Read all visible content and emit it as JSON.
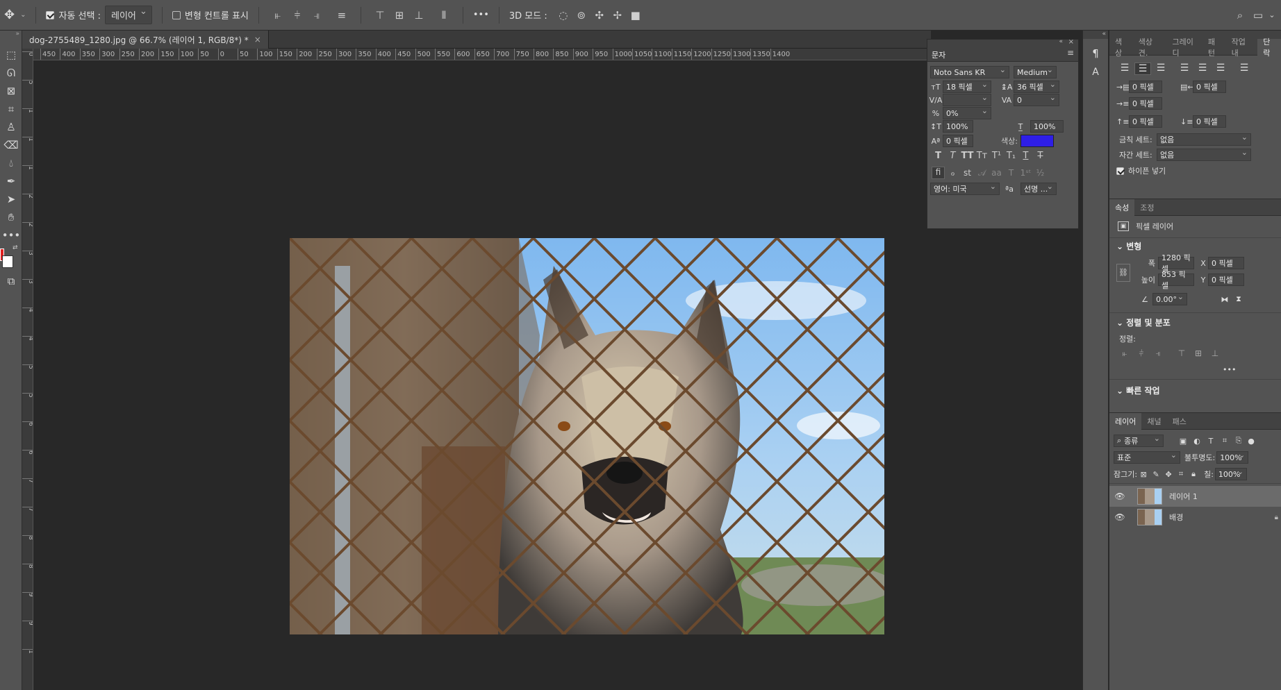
{
  "options_bar": {
    "auto_select_label": "자동 선택 :",
    "auto_select_value": "레이어",
    "transform_controls_label": "변형 컨트롤 표시",
    "mode_3d_label": "3D 모드 :",
    "more": "•••"
  },
  "document": {
    "tab_title": "dog-2755489_1280.jpg @ 66.7% (레이어 1, RGB/8*) *",
    "close": "×"
  },
  "ruler": {
    "h_labels": [
      "450",
      "400",
      "350",
      "300",
      "250",
      "200",
      "150",
      "100",
      "50",
      "0",
      "50",
      "100",
      "150",
      "200",
      "250",
      "300",
      "350",
      "400",
      "450",
      "500",
      "550",
      "600",
      "650",
      "700",
      "750",
      "800",
      "850",
      "900",
      "950",
      "1000",
      "1050",
      "1100",
      "1150",
      "1200",
      "1250",
      "1300",
      "1350",
      "1400"
    ],
    "v_labels": [
      "0",
      "5",
      "1",
      "1",
      "1",
      "2",
      "2",
      "3",
      "3",
      "4",
      "4",
      "5",
      "5",
      "6",
      "6",
      "7",
      "7",
      "8",
      "8",
      "9",
      "9",
      "1"
    ]
  },
  "character_panel": {
    "title": "문자",
    "font_family": "Noto Sans KR",
    "font_style": "Medium",
    "font_size": "18 픽셀",
    "leading": "36 픽셀",
    "kerning": "",
    "tracking": "0",
    "tsume": "0%",
    "vertical_scale": "100%",
    "horizontal_scale": "100%",
    "baseline_shift": "0 픽셀",
    "color_label": "색상:",
    "color_swatch": "#2e1ee6",
    "language": "영어: 미국",
    "antialias_icon": "ªa",
    "antialias": "선명 ..."
  },
  "right_dock": {
    "top_tabs": [
      "색상",
      "색상 견.",
      "그레이디",
      "패턴",
      "작업 내",
      "단락"
    ],
    "paragraph": {
      "indent_left": "0 픽셀",
      "indent_right": "0 픽셀",
      "indent_first": "0 픽셀",
      "space_before": "0 픽셀",
      "space_after": "0 픽셀",
      "kinsoku_label": "금칙 세트:",
      "kinsoku_value": "없음",
      "mojikumi_label": "자간 세트:",
      "mojikumi_value": "없음",
      "hyphenate_label": "하이픈 넣기"
    },
    "props_tabs": [
      "속성",
      "조정"
    ],
    "properties": {
      "layer_type": "픽셀 레이어",
      "transform_title": "변형",
      "width_label": "폭",
      "width_value": "1280 픽셀",
      "x_label": "X",
      "x_value": "0 픽셀",
      "height_label": "높이",
      "height_value": "853 픽셀",
      "y_label": "Y",
      "y_value": "0 픽셀",
      "angle_value": "0.00°",
      "align_title": "정렬 및 분포",
      "align_label": "정렬:",
      "quick_title": "빠른 작업",
      "more": "•••"
    },
    "layers_tabs": [
      "레이어",
      "채널",
      "패스"
    ],
    "layers": {
      "filter_kind": "종류",
      "blend_mode": "표준",
      "opacity_label": "불투명도:",
      "opacity_value": "100%",
      "lock_label": "잠그기:",
      "fill_label": "칠:",
      "fill_value": "100%",
      "items": [
        {
          "name": "레이어 1"
        },
        {
          "name": "배경"
        }
      ]
    }
  },
  "colors": {
    "foreground": "#e02020",
    "background": "#ffffff"
  }
}
